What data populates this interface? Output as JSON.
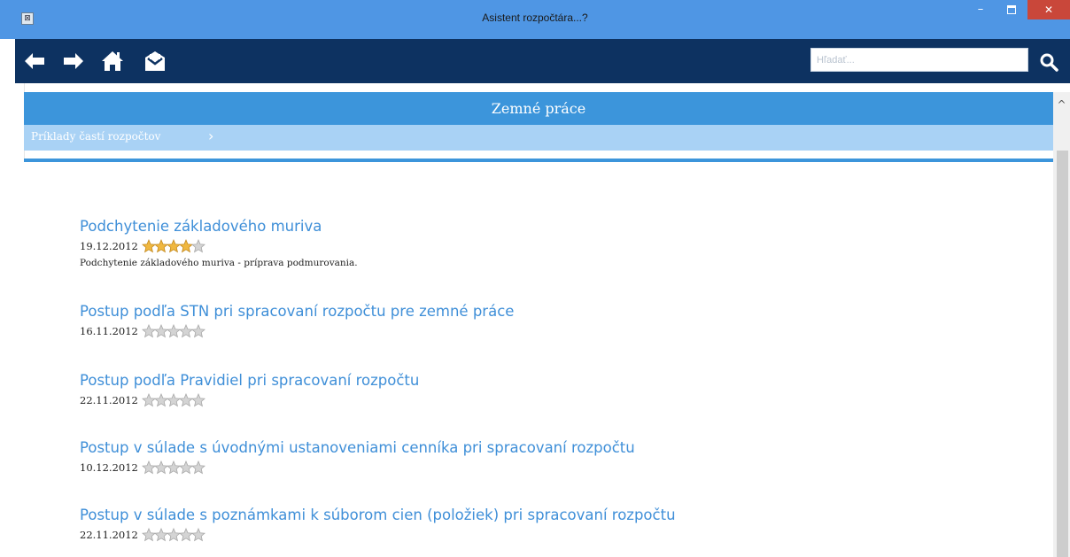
{
  "window": {
    "title": "Asistent rozpočtára...?",
    "minimize_label": "–",
    "close_label": "✕"
  },
  "toolbar": {
    "icons": [
      "back-arrow-icon",
      "forward-arrow-icon",
      "home-icon",
      "mail-icon",
      "search-icon"
    ],
    "search_placeholder": "Hľadať..."
  },
  "page": {
    "header": "Zemné práce",
    "breadcrumb": "Príklady častí rozpočtov"
  },
  "articles": [
    {
      "title": "Podchytenie základového muriva",
      "date": "19.12.2012",
      "rating": 4,
      "description": "Podchytenie základového muriva - príprava podmurovania."
    },
    {
      "title": "Postup podľa STN pri spracovaní rozpočtu pre zemné práce",
      "date": "16.11.2012",
      "rating": 0
    },
    {
      "title": "Postup podľa Pravidiel pri spracovaní rozpočtu",
      "date": "22.11.2012",
      "rating": 0
    },
    {
      "title": "Postup v súlade s úvodnými ustanoveniami cenníka pri spracovaní rozpočtu",
      "date": "10.12.2012",
      "rating": 0
    },
    {
      "title": "Postup v súlade s poznámkami k súborom cien (položiek) pri spracovaní rozpočtu",
      "date": "22.11.2012",
      "rating": 0
    }
  ],
  "colors": {
    "titlebar": "#4f96e4",
    "toolbar": "#0d3261",
    "accent": "#3c95db",
    "link": "#3f8fd8",
    "star_filled": "#f0b840",
    "star_empty": "#d4d4d4"
  }
}
